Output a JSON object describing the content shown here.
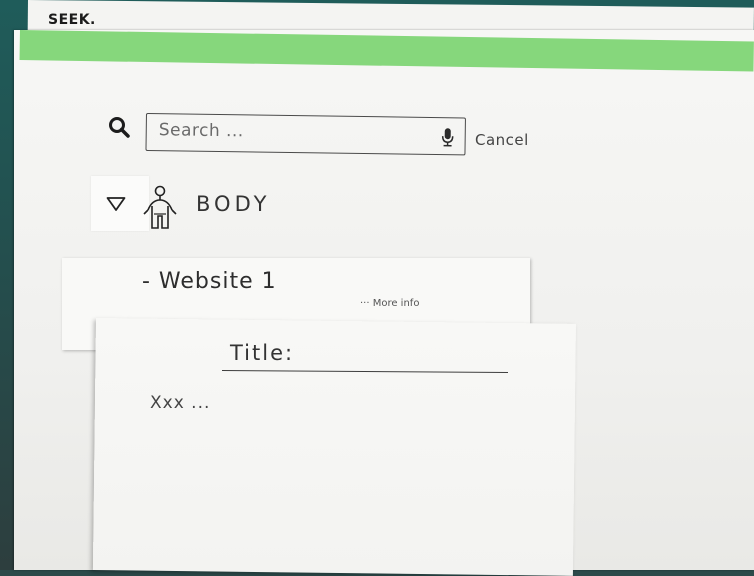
{
  "app": {
    "brand": "SEEK."
  },
  "search": {
    "placeholder": "Search ...",
    "cancel_label": "Cancel"
  },
  "category": {
    "label": "BODY"
  },
  "result": {
    "title": "- Website 1",
    "more_info": "··· More info"
  },
  "detail": {
    "title": "Title:",
    "body": "Xxx ..."
  },
  "icons": {
    "search": "search-icon",
    "mic": "mic-icon",
    "collapse": "triangle-down-icon",
    "body": "body-figure-icon"
  },
  "colors": {
    "accent_bar": "#86d77c",
    "paper": "#f4f4f2",
    "backdrop": "#23504f"
  }
}
